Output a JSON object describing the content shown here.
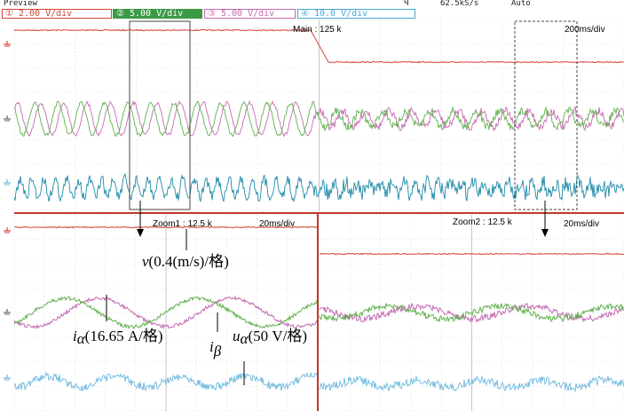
{
  "header": {
    "mode": "Preview",
    "trigger_marker": "Ч",
    "sample_rate": "62.5kS/s",
    "trigger_mode": "Auto"
  },
  "channels": [
    {
      "id": "1",
      "label": "2.00 V/div",
      "color": "#d2453a"
    },
    {
      "id": "2",
      "label": "5.00 V/div",
      "color": "#3c9a46"
    },
    {
      "id": "3",
      "label": "5.00 V/div",
      "color": "#c46bb0"
    },
    {
      "id": "4",
      "label": "10.0 V/div",
      "color": "#47a9d4"
    }
  ],
  "main": {
    "label": "Main : 125 k",
    "timebase": "200ms/div"
  },
  "zoom1": {
    "label": "Zoom1 : 12.5 k",
    "timebase": "20ms/div"
  },
  "zoom2": {
    "label": "Zoom2 : 12.5 k",
    "timebase": "20ms/div"
  },
  "annotations": {
    "v_symbol": "v",
    "v_text": "(0.4(m/s)/格)",
    "ialpha_symbol": "i",
    "ialpha_sub": "α",
    "ialpha_text": "(16.65 A/格)",
    "ibeta_symbol": "i",
    "ibeta_sub": "β",
    "ualpha_symbol": "u",
    "ualpha_sub": "α",
    "ualpha_text": "(50 V/格)"
  },
  "colors": {
    "speed": "#d2453a",
    "current_alpha": "#c46bb0",
    "current_beta": "#5fb04c",
    "voltage": "#1f8aa8",
    "voltage_zoom": "#6cb8dc",
    "divider": "#c0392b"
  }
}
